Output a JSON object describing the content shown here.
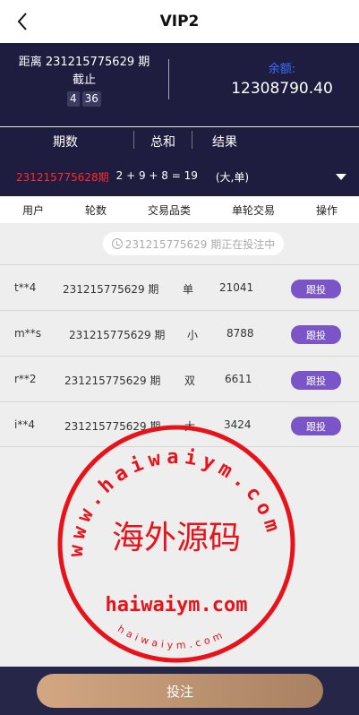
{
  "header": {
    "title": "VIP2",
    "back_icon": "chevron-left-icon"
  },
  "period": {
    "prefix": "距离",
    "issue": "231215775629",
    "suffix": "期",
    "deadline_label": "截止",
    "timer_min": "4",
    "timer_sec": "36"
  },
  "balance": {
    "label": "余额:",
    "value": "12308790.40",
    "label_color": "#3d6dff"
  },
  "results_header": {
    "col_issue": "期数",
    "col_sum": "总和",
    "col_result": "结果"
  },
  "latest_result": {
    "issue": "231215775628期",
    "formula": "2 + 9 + 8 = 19",
    "result": "(大,单)",
    "dropdown_icon": "triangle-down-icon",
    "issue_color": "#ff2a2a"
  },
  "table": {
    "headers": [
      "用户",
      "轮数",
      "交易品类",
      "单轮交易",
      "操作"
    ],
    "status": "231215775629 期正在投注中",
    "rows": [
      {
        "user": "t**4",
        "round": "231215775629 期",
        "category": "单",
        "amount": "21041",
        "action": "跟投"
      },
      {
        "user": "m**s",
        "round": "231215775629 期",
        "category": "小",
        "amount": "8788",
        "action": "跟投"
      },
      {
        "user": "r**2",
        "round": "231215775629 期",
        "category": "双",
        "amount": "6611",
        "action": "跟投"
      },
      {
        "user": "i**4",
        "round": "231215775629 期",
        "category": "大",
        "amount": "3424",
        "action": "跟投"
      }
    ]
  },
  "watermark": {
    "top": "www.haiwaiym.com",
    "center": "海外源码",
    "bottom": "haiwaiym.com",
    "small": "haiwaiym.com",
    "color": "#e8121a"
  },
  "footer": {
    "bet_label": "投注"
  }
}
